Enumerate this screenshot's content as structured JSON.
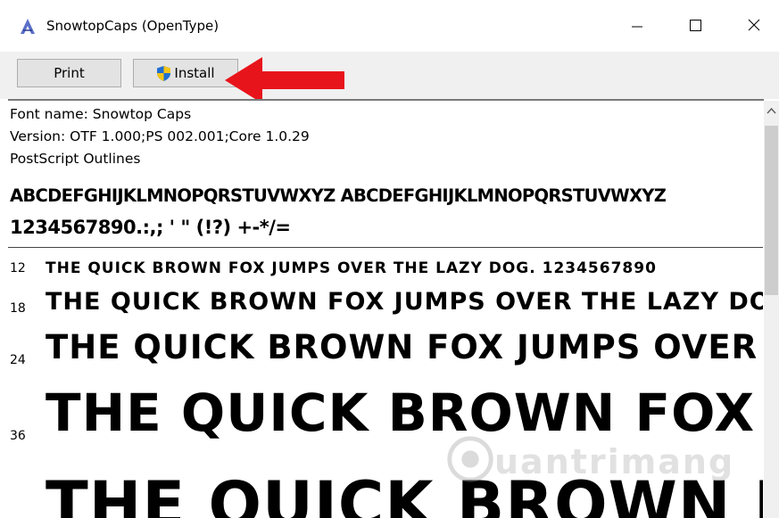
{
  "window": {
    "title": "SnowtopCaps (OpenType)",
    "icon": "font-viewer-icon"
  },
  "toolbar": {
    "print_label": "Print",
    "install_label": "Install"
  },
  "font_info": {
    "name_line": "Font name: Snowtop Caps",
    "version_line": "Version: OTF 1.000;PS 002.001;Core 1.0.29",
    "outline_line": "PostScript Outlines"
  },
  "glyphs": {
    "line1": "ABCDEFGHIJKLMNOPQRSTUVWXYZ ABCDEFGHIJKLMNOPQRSTUVWXYZ",
    "line2": "1234567890.:,; ' \" (!?) +-*/="
  },
  "samples": [
    {
      "size": "12",
      "text": "THE QUICK BROWN FOX JUMPS OVER THE LAZY DOG. 1234567890"
    },
    {
      "size": "18",
      "text": "THE QUICK BROWN FOX JUMPS OVER THE LAZY DOG."
    },
    {
      "size": "24",
      "text": "THE QUICK BROWN FOX JUMPS OVER TH"
    },
    {
      "size": "36",
      "text": "THE QUICK BROWN FOX JU"
    },
    {
      "size": "",
      "text": "THE QUICK BROWN F"
    }
  ],
  "watermark": {
    "text": "uantrimang"
  },
  "colors": {
    "arrow": "#e8141b",
    "shield_blue": "#1f6fd1",
    "shield_yellow": "#f5c518"
  }
}
